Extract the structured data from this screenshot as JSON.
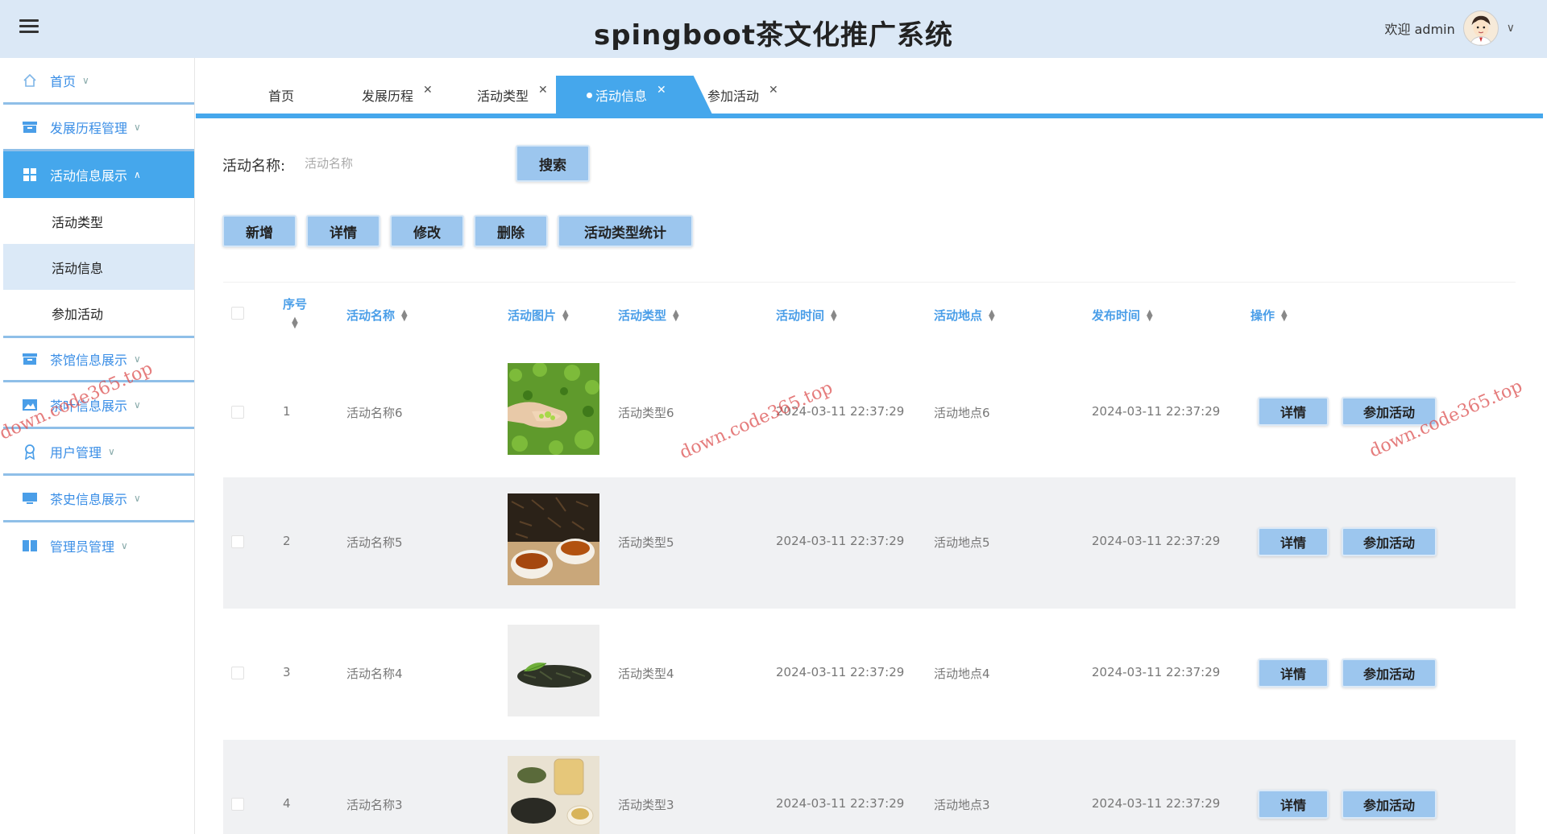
{
  "header": {
    "title": "spingboot茶文化推广系统",
    "welcome": "欢迎 admin"
  },
  "sidebar": {
    "items": [
      {
        "label": "首页",
        "icon": "home-icon"
      },
      {
        "label": "发展历程管理",
        "icon": "box-icon"
      },
      {
        "label": "活动信息展示",
        "icon": "grid-icon",
        "expanded": true,
        "children": [
          "活动类型",
          "活动信息",
          "参加活动"
        ],
        "active_child": "活动信息"
      },
      {
        "label": "茶馆信息展示",
        "icon": "box-icon"
      },
      {
        "label": "茶叶信息展示",
        "icon": "image-icon"
      },
      {
        "label": "用户管理",
        "icon": "badge-icon"
      },
      {
        "label": "茶史信息展示",
        "icon": "monitor-icon"
      },
      {
        "label": "管理员管理",
        "icon": "book-icon"
      }
    ]
  },
  "tabs": [
    {
      "label": "首页",
      "closable": false
    },
    {
      "label": "发展历程",
      "closable": true
    },
    {
      "label": "活动类型",
      "closable": true
    },
    {
      "label": "活动信息",
      "closable": true,
      "active": true
    },
    {
      "label": "参加活动",
      "closable": true
    }
  ],
  "search": {
    "label": "活动名称:",
    "placeholder": "活动名称",
    "button": "搜索"
  },
  "actions": {
    "add": "新增",
    "detail": "详情",
    "edit": "修改",
    "delete": "删除",
    "stats": "活动类型统计"
  },
  "table": {
    "columns": [
      "序号",
      "活动名称",
      "活动图片",
      "活动类型",
      "活动时间",
      "活动地点",
      "发布时间",
      "操作"
    ],
    "row_buttons": {
      "detail": "详情",
      "join": "参加活动"
    },
    "rows": [
      {
        "index": "1",
        "name": "活动名称6",
        "image": "tea-picking-hands",
        "type": "活动类型6",
        "time": "2024-03-11 22:37:29",
        "place": "活动地点6",
        "published": "2024-03-11 22:37:29"
      },
      {
        "index": "2",
        "name": "活动名称5",
        "image": "black-tea-cups",
        "type": "活动类型5",
        "time": "2024-03-11 22:37:29",
        "place": "活动地点5",
        "published": "2024-03-11 22:37:29"
      },
      {
        "index": "3",
        "name": "活动名称4",
        "image": "dry-tea-leaves",
        "type": "活动类型4",
        "time": "2024-03-11 22:37:29",
        "place": "活动地点4",
        "published": "2024-03-11 22:37:29"
      },
      {
        "index": "4",
        "name": "活动名称3",
        "image": "tea-set",
        "type": "活动类型3",
        "time": "2024-03-11 22:37:29",
        "place": "活动地点3",
        "published": "2024-03-11 22:37:29"
      }
    ]
  },
  "watermark": "down.code365.top",
  "colors": {
    "accent": "#45a7ec",
    "header_bg": "#dbe8f6",
    "button_bg": "#9cc6ee",
    "column_header": "#4a9ee8"
  }
}
